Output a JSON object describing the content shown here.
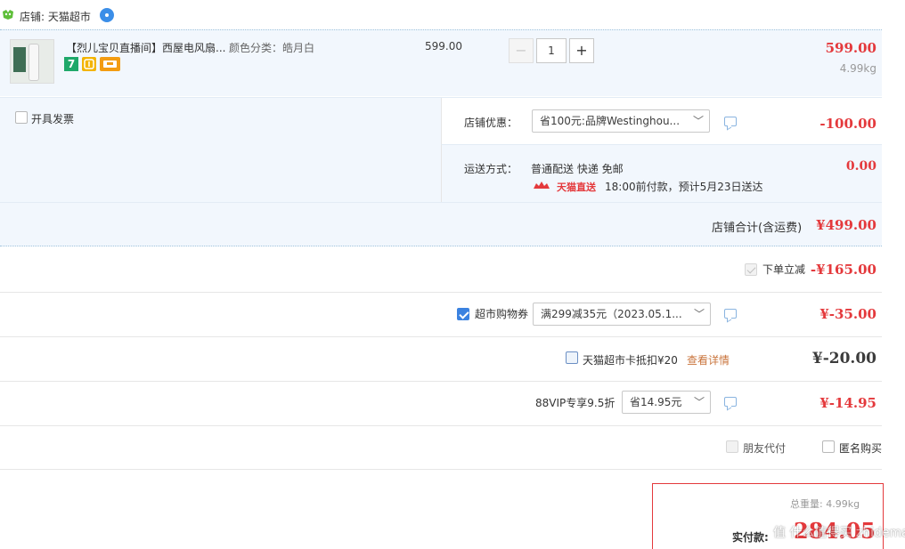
{
  "shop": {
    "label": "店铺: 天猫超市"
  },
  "item": {
    "title": "【烈儿宝贝直播间】西屋电风扇...",
    "variant": "颜色分类：皓月白",
    "unit_price": "599.00",
    "quantity": "1",
    "minus": "−",
    "plus": "+",
    "subtotal": "599.00",
    "weight": "4.99kg",
    "badge_7": "7"
  },
  "invoice": {
    "label": "开具发票"
  },
  "shop_discount": {
    "label": "店铺优惠：",
    "selected": "省100元:品牌Westinghou...",
    "amount": "-100.00"
  },
  "shipping": {
    "label": "运送方式：",
    "method": "普通配送 快递 免邮",
    "amount": "0.00",
    "brand": "天猫直送",
    "eta": "18:00前付款，预计5月23日送达"
  },
  "shop_total": {
    "label": "店铺合计(含运费)",
    "amount": "¥499.00"
  },
  "instant_discount": {
    "label": "下单立减",
    "amount": "-¥165.00"
  },
  "coupon": {
    "label": "超市购物券",
    "selected": "满299减35元（2023.05.1...",
    "amount": "¥-35.00"
  },
  "card": {
    "label": "天猫超市卡抵扣¥20",
    "link": "查看详情",
    "amount": "¥-20.00"
  },
  "vip": {
    "label": "88VIP专享9.5折",
    "selected": "省14.95元",
    "amount": "¥-14.95"
  },
  "options": {
    "friend_pay": "朋友代付",
    "anonymous": "匿名购买"
  },
  "summary": {
    "pay_label": "实付款:",
    "pay_amount": "284.05",
    "weight_label": "总重量: 4.99kg"
  },
  "watermark": "值 什么值得买 zhidemai.com",
  "colors": {
    "accent": "#e4393c",
    "light_blue_bg": "#f2f7fd",
    "link": "#c9743c",
    "checkbox": "#3b82e0"
  }
}
